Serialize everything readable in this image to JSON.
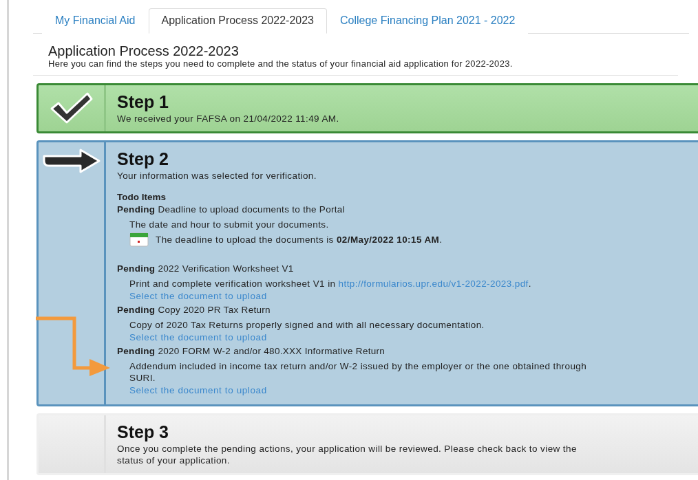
{
  "tabs": [
    {
      "label": "My Financial Aid",
      "selected": false
    },
    {
      "label": "Application Process 2022-2023",
      "selected": true
    },
    {
      "label": "College Financing Plan 2021 - 2022",
      "selected": false
    }
  ],
  "header": {
    "title": "Application Process 2022-2023",
    "description": "Here you can find the steps you need to complete and the status of your financial aid application for 2022-2023."
  },
  "steps": [
    {
      "kind": "done",
      "title": "Step 1",
      "text": "We received your FAFSA on 21/04/2022 11:49 AM."
    },
    {
      "kind": "current",
      "title": "Step 2",
      "text": "Your information was selected for verification.",
      "todo_heading": "Todo Items",
      "todo_items": [
        {
          "status": "Pending",
          "title": "Deadline to upload documents to the Portal",
          "description": "The date and hour to submit your documents.",
          "deadline": "The deadline to upload the documents is **02/May/2022 10:15 AM**."
        },
        {
          "status": "Pending",
          "title": "2022 Verification Worksheet V1",
          "description": "Print and complete verification worksheet V1 in",
          "link": "http://formularios.upr.edu/v1-2022-2023.pdf",
          "description_end": ".",
          "upload_link": "Select the document to upload"
        },
        {
          "status": "Pending",
          "title": "Copy 2020 PR Tax Return",
          "description": "Copy of 2020 Tax Returns properly signed and with all necessary documentation.",
          "upload_link": "Select the document to upload"
        },
        {
          "status": "Pending",
          "title": "2020 FORM W-2 and/or 480.XXX Informative Return",
          "description": "Addendum included in income tax return and/or W-2 issued by the employer or the one obtained through SURI.",
          "upload_link": "Select the document to upload",
          "annotated": true
        }
      ]
    },
    {
      "kind": "upcoming",
      "title": "Step 3",
      "text": "Once you complete the pending actions, your application will be reviewed. Please check back to view the status of your application."
    }
  ]
}
